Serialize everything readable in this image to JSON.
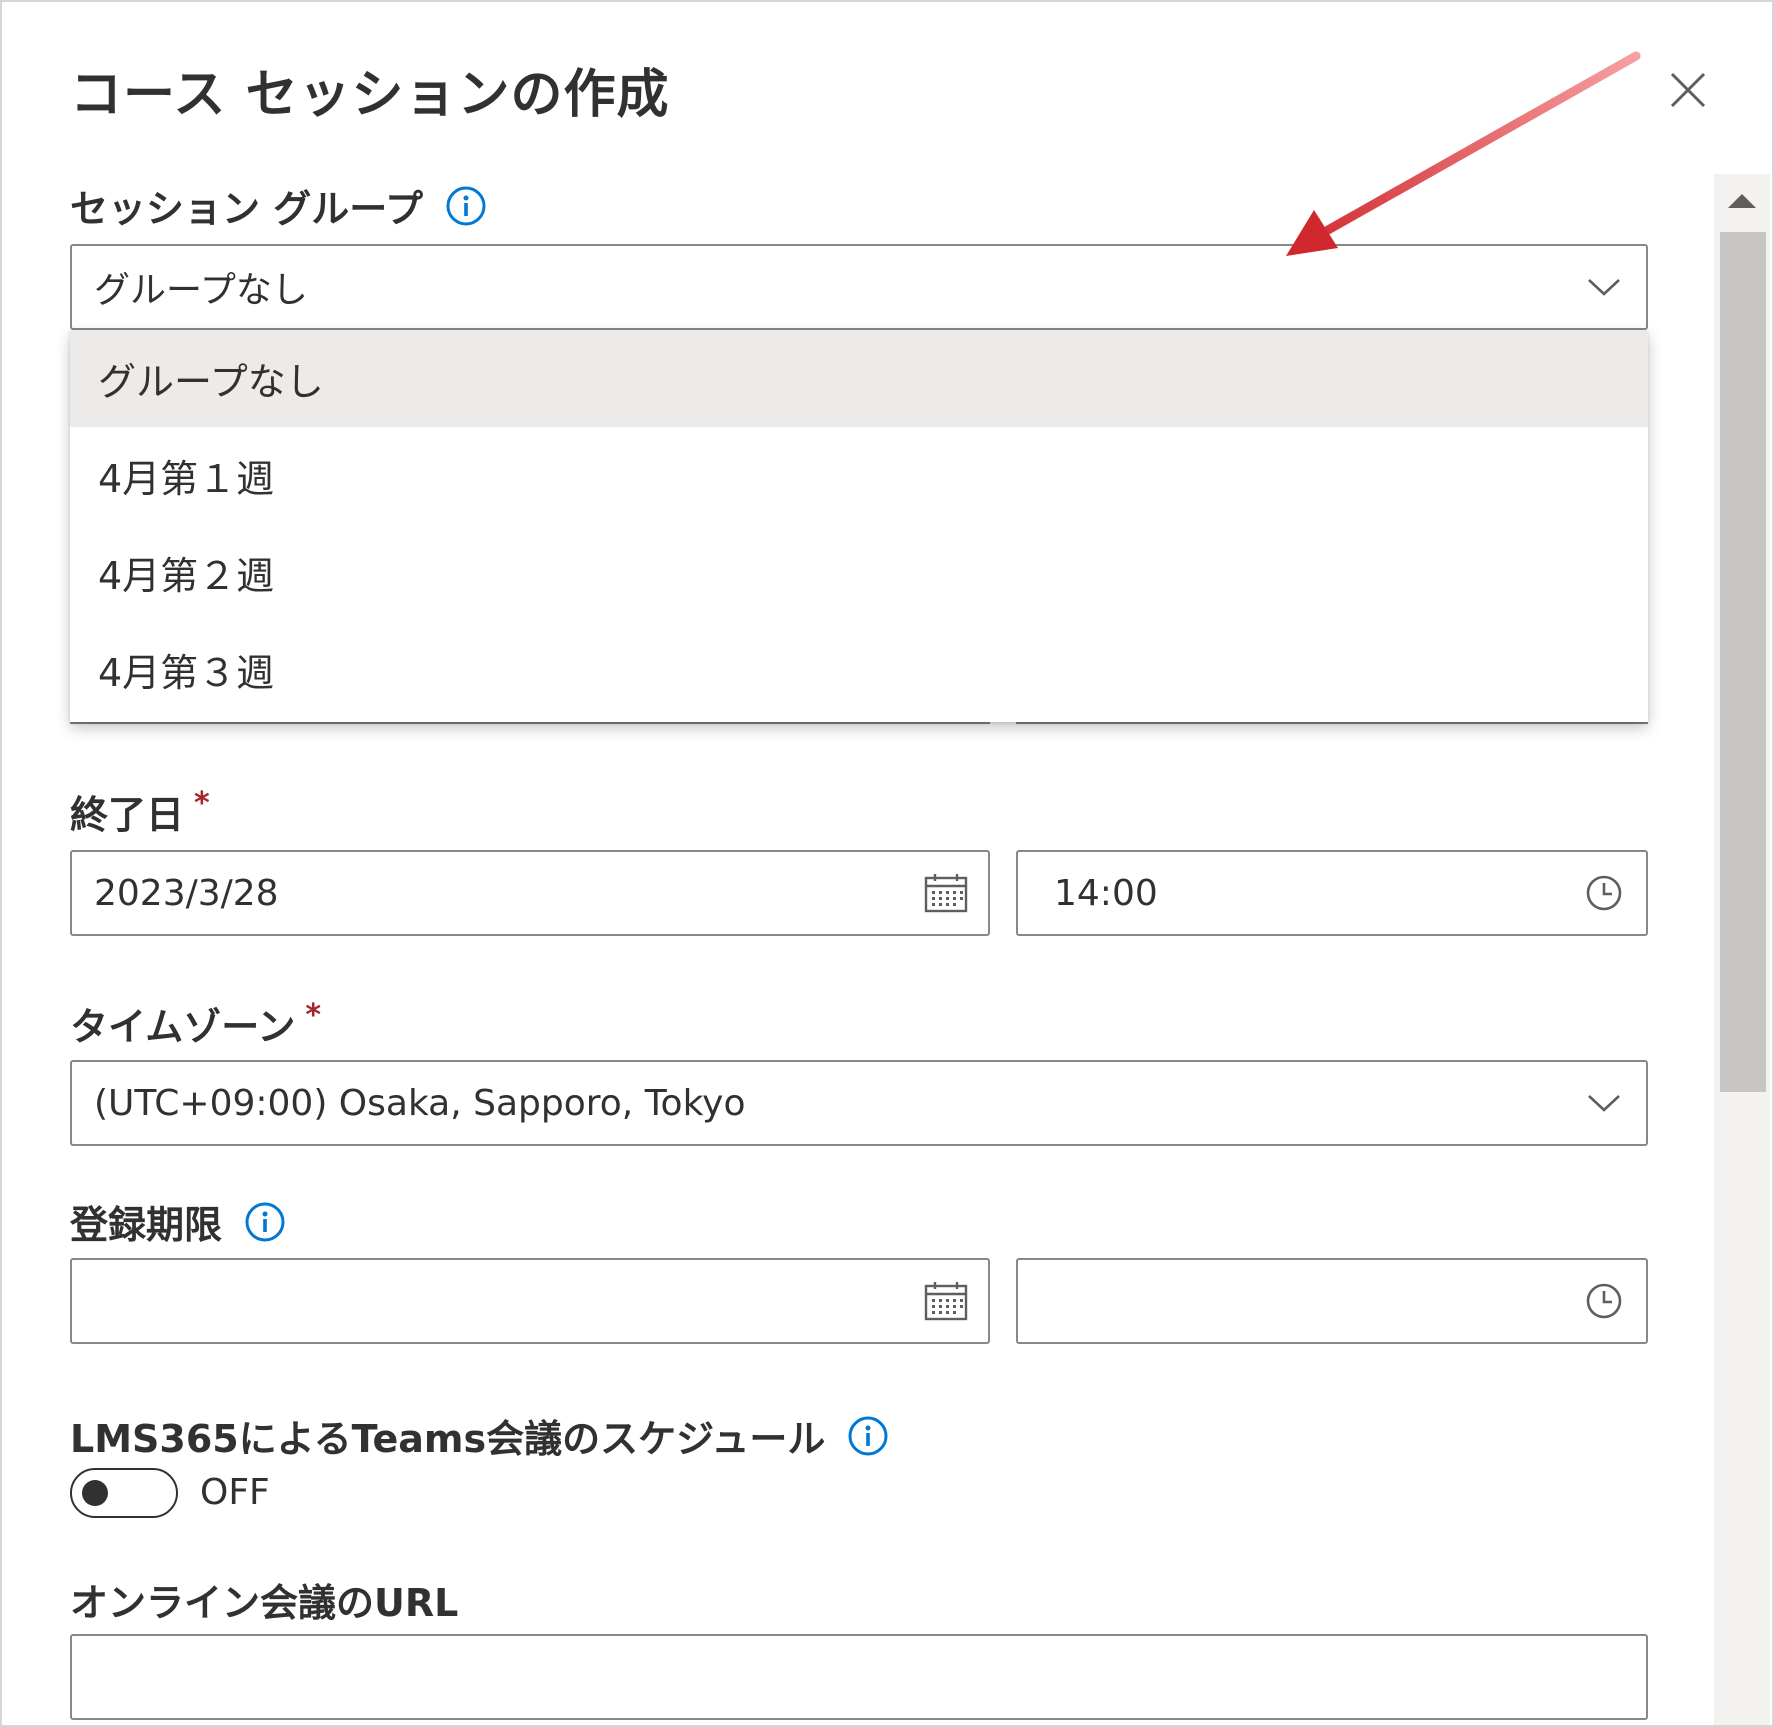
{
  "dialog": {
    "title": "コース セッションの作成",
    "close_icon": "close-icon"
  },
  "session_group": {
    "label": "セッション グループ",
    "selected": "グループなし",
    "options": [
      "グループなし",
      "4月第１週",
      "4月第２週",
      "4月第３週"
    ]
  },
  "end_date": {
    "label": "終了日",
    "required": "*",
    "date": "2023/3/28",
    "time": "14:00"
  },
  "timezone": {
    "label": "タイムゾーン",
    "required": "*",
    "value": "(UTC+09:00) Osaka, Sapporo, Tokyo"
  },
  "registration_deadline": {
    "label": "登録期限",
    "date": "",
    "time": ""
  },
  "teams_meeting": {
    "label": "LMS365によるTeams会議のスケジュール",
    "toggle_state": "OFF"
  },
  "online_meeting_url": {
    "label": "オンライン会議のURL",
    "value": ""
  },
  "colors": {
    "accent_info": "#0078d4",
    "required": "#a4262c",
    "annotation_arrow": "#d0282e"
  }
}
